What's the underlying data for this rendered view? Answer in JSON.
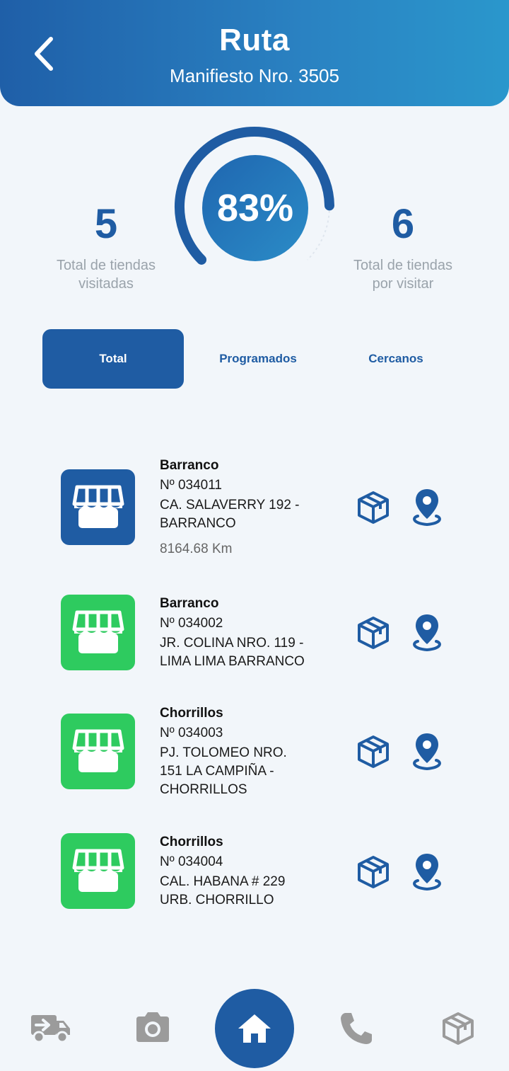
{
  "header": {
    "title": "Ruta",
    "subtitle": "Manifiesto Nro. 3505",
    "back_icon": "chevron-left-icon"
  },
  "stats": {
    "visited": {
      "value": "5",
      "label_line1": "Total de tiendas",
      "label_line2": "visitadas"
    },
    "pending": {
      "value": "6",
      "label_line1": "Total de tiendas",
      "label_line2": "por visitar"
    }
  },
  "gauge": {
    "percent_text": "83%",
    "progress": 0.83,
    "color": "#1f5ca3"
  },
  "tabs": [
    {
      "label": "Total",
      "active": true
    },
    {
      "label": "Programados",
      "active": false
    },
    {
      "label": "Cercanos",
      "active": false
    }
  ],
  "stores": [
    {
      "name": "Barranco",
      "number": "Nº 034011",
      "address_line1": "CA. SALAVERRY 192 -",
      "address_line2": "BARRANCO",
      "address_line3": "",
      "distance": "8164.68 Km",
      "icon_color": "blue"
    },
    {
      "name": "Barranco",
      "number": "Nº 034002",
      "address_line1": "JR. COLINA NRO. 119 -",
      "address_line2": "LIMA LIMA BARRANCO",
      "address_line3": "",
      "distance": "",
      "icon_color": "green"
    },
    {
      "name": "Chorrillos",
      "number": "Nº 034003",
      "address_line1": "PJ. TOLOMEO NRO.",
      "address_line2": "151 LA CAMPIÑA -",
      "address_line3": "CHORRILLOS",
      "distance": "",
      "icon_color": "green"
    },
    {
      "name": "Chorrillos",
      "number": "Nº 034004",
      "address_line1": "CAL. HABANA # 229",
      "address_line2": "URB. CHORRILLO",
      "address_line3": "",
      "distance": "",
      "icon_color": "green"
    }
  ],
  "bottom_nav": [
    {
      "icon": "truck-icon"
    },
    {
      "icon": "camera-icon"
    },
    {
      "icon": "home-icon",
      "active": true
    },
    {
      "icon": "phone-icon"
    },
    {
      "icon": "package-icon"
    }
  ],
  "colors": {
    "primary": "#1f5ca3",
    "green": "#2ecb5f",
    "muted": "#9aa3ab",
    "nav_inactive": "#9b9b9b"
  }
}
